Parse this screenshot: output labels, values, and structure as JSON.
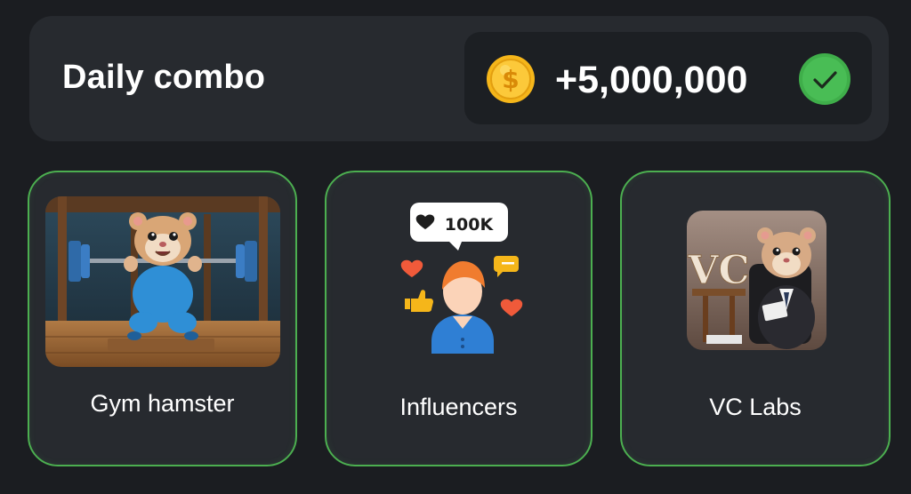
{
  "combo": {
    "title": "Daily combo",
    "reward": "+5,000,000",
    "coin_icon": "dollar-coin-icon",
    "status_icon": "check-circle-icon",
    "accent_color": "#4caf50",
    "coin_color": "#f5b61a"
  },
  "cards": [
    {
      "label": "Gym hamster",
      "image": "gym-hamster-image"
    },
    {
      "label": "Influencers",
      "image": "influencer-image",
      "badge_text": "100K"
    },
    {
      "label": "VC Labs",
      "image": "vc-labs-hamster-image",
      "sign_text": "VC"
    }
  ]
}
